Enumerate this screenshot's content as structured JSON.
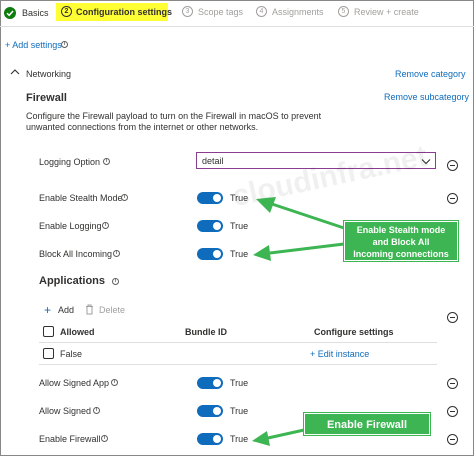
{
  "wizard": {
    "steps": [
      {
        "num": "",
        "label": "Basics"
      },
      {
        "num": "2",
        "label": "Configuration settings"
      },
      {
        "num": "3",
        "label": "Scope tags"
      },
      {
        "num": "4",
        "label": "Assignments"
      },
      {
        "num": "5",
        "label": "Review + create"
      }
    ]
  },
  "add_settings": "+ Add settings",
  "category": {
    "name": "Networking",
    "remove": "Remove category"
  },
  "subcategory": {
    "title": "Firewall",
    "remove": "Remove subcategory",
    "description": "Configure the Firewall payload to turn on the Firewall in macOS to prevent unwanted connections from the internet or other networks."
  },
  "settings": {
    "logging_option": {
      "label": "Logging Option",
      "value": "detail"
    },
    "stealth": {
      "label": "Enable Stealth Mode",
      "value": "True"
    },
    "logging": {
      "label": "Enable Logging",
      "value": "True"
    },
    "block_all": {
      "label": "Block All Incoming",
      "value": "True"
    },
    "allow_signed_app": {
      "label": "Allow Signed App",
      "value": "True"
    },
    "allow_signed": {
      "label": "Allow Signed",
      "value": "True"
    },
    "enable_firewall": {
      "label": "Enable Firewall",
      "value": "True"
    }
  },
  "applications": {
    "title": "Applications",
    "add": "Add",
    "delete": "Delete",
    "columns": [
      "Allowed",
      "Bundle ID",
      "Configure settings"
    ],
    "rows": [
      {
        "allowed": "False",
        "edit": "+ Edit instance"
      }
    ]
  },
  "watermark": "cloudinfra.net",
  "annotations": {
    "callout1": [
      "Enable Stealth mode",
      "and Block All",
      "Incoming connections"
    ],
    "callout2": "Enable Firewall",
    "arrow_color": "#3db552"
  },
  "colors": {
    "accent": "#0f6cbd",
    "highlight": "#ffff33",
    "dropdown_border": "#8a3c8f"
  }
}
